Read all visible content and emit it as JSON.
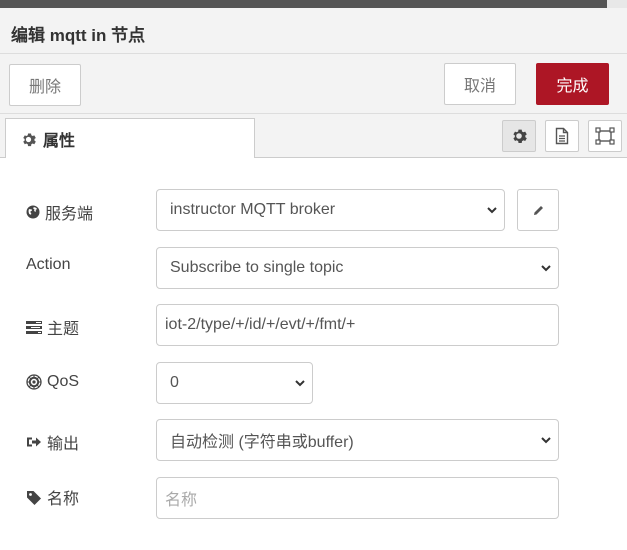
{
  "header": {
    "title": "编辑 mqtt in 节点"
  },
  "toolbar": {
    "delete_label": "删除",
    "cancel_label": "取消",
    "done_label": "完成"
  },
  "tabs": [
    {
      "label": "属性",
      "icon": "gear-icon"
    }
  ],
  "tab_icons": [
    "gear-icon",
    "document-icon",
    "frame-icon"
  ],
  "form": {
    "server": {
      "label": "服务端",
      "value": "instructor MQTT broker",
      "icon": "globe-icon"
    },
    "action": {
      "label": "Action",
      "value": "Subscribe to single topic"
    },
    "topic": {
      "label": "主题",
      "value": "iot-2/type/+/id/+/evt/+/fmt/+",
      "icon": "tasks-icon"
    },
    "qos": {
      "label": "QoS",
      "value": "0",
      "icon": "empire-icon"
    },
    "output": {
      "label": "输出",
      "value": "自动检测 (字符串或buffer)",
      "icon": "sign-out-icon"
    },
    "name": {
      "label": "名称",
      "value": "",
      "placeholder": "名称",
      "icon": "tag-icon"
    }
  },
  "colors": {
    "primary": "#ad1625",
    "toolbar_bg": "#f3f3f3",
    "border": "#cccccc"
  }
}
